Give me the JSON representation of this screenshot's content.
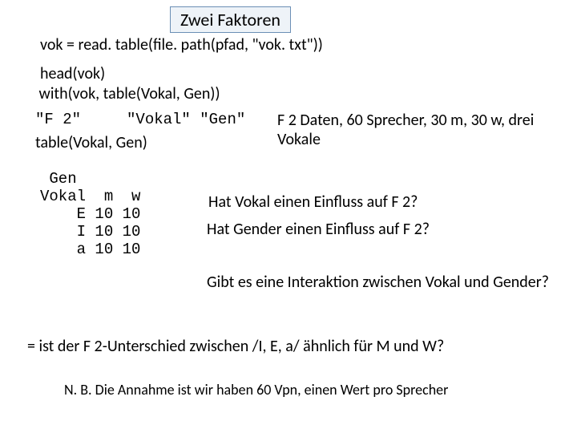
{
  "title": "Zwei Faktoren",
  "code": {
    "l1": "vok = read. table(file. path(pfad, \"vok. txt\"))",
    "l2": "head(vok)",
    "l3": " with(vok, table(Vokal, Gen))",
    "out1": "\"F 2\"     \"Vokal\" \"Gen\"",
    "l4": "table(Vokal, Gen)"
  },
  "table": {
    "r1": " Gen",
    "r2": "Vokal  m  w",
    "r3": "    E 10 10",
    "r4": "    I 10 10",
    "r5": "    a 10 10"
  },
  "desc": "F 2 Daten, 60 Sprecher, 30 m, 30 w, drei Vokale",
  "q1": "Hat Vokal einen Einfluss auf F 2?",
  "q2": "Hat Gender einen Einfluss auf F 2?",
  "q3": "Gibt es eine Interaktion zwischen Vokal und Gender?",
  "eq": "= ist der F 2-Unterschied zwischen /I, E, a/ ähnlich für M und W?",
  "nb": "N. B. Die Annahme ist wir haben 60 Vpn, einen Wert pro Sprecher"
}
